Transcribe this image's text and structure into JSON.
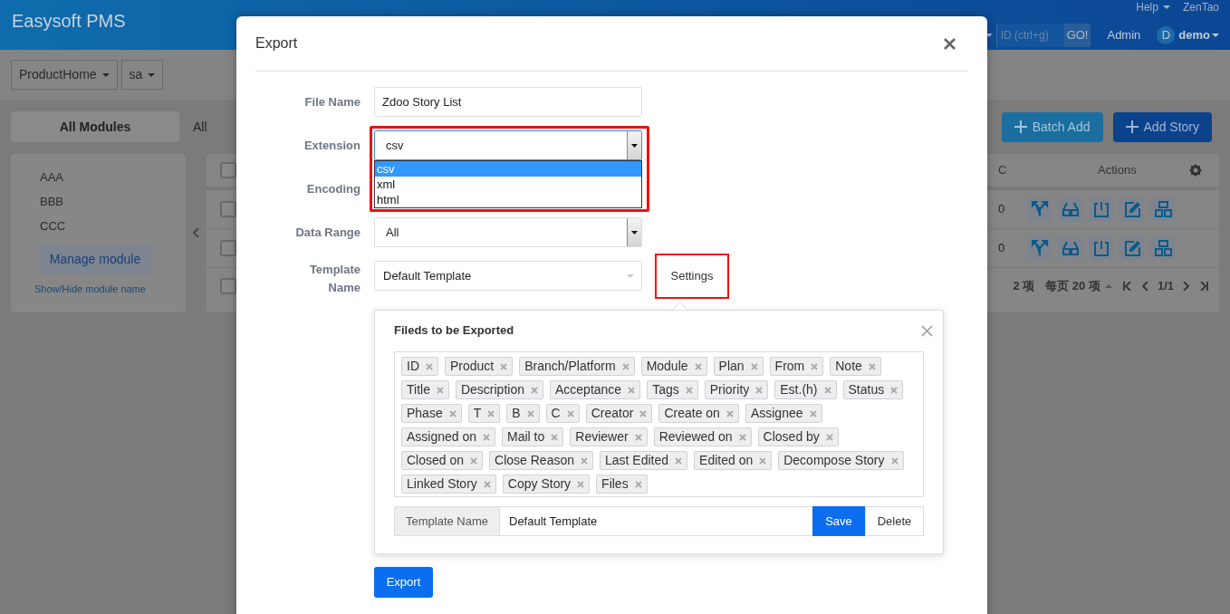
{
  "header": {
    "brand": "Easysoft PMS",
    "help": "Help",
    "zentao": "ZenTao",
    "search": {
      "placeholder": "ID (ctrl+g)"
    },
    "go": "GO!",
    "admin": "Admin",
    "avatar": "D",
    "user": "demo"
  },
  "breadcrumb": [
    "ProductHome",
    "sa"
  ],
  "sidebar": {
    "title": "All Modules",
    "modules": [
      "AAA",
      "BBB",
      "CCC"
    ],
    "manage": "Manage module",
    "toggle": "Show/Hide module name"
  },
  "toolbar": {
    "filter": "All",
    "buttons": [
      {
        "label": "Batch Add",
        "kind": "secondary"
      },
      {
        "label": "Add Story",
        "kind": "primary"
      }
    ]
  },
  "table": {
    "header_checked": false,
    "columns": [
      "C",
      "Actions"
    ],
    "rows": [
      {
        "checked": false,
        "c": "0"
      },
      {
        "checked": false,
        "c": "0"
      }
    ],
    "footer": {
      "checked": false,
      "total": "2 项",
      "per_page": "每页 20 项",
      "page": "1/1"
    }
  },
  "dialog": {
    "title": "Export",
    "fields": [
      {
        "label": "File Name",
        "kind": "text",
        "value": "Zdoo Story List"
      },
      {
        "label": "Extension",
        "kind": "select",
        "value": "csv",
        "highlighted": true,
        "expanded": true,
        "options": [
          {
            "label": "csv",
            "selected": true
          },
          {
            "label": "xml",
            "selected": false
          },
          {
            "label": "html",
            "selected": false
          }
        ]
      },
      {
        "label": "Encoding"
      },
      {
        "label": "Data Range",
        "kind": "select",
        "value": "All"
      },
      {
        "label": "Template Name",
        "kind": "chosen",
        "value": "Default Template",
        "button": "Settings",
        "button_highlighted": true
      }
    ],
    "popover": {
      "title": "Fileds to be Exported",
      "tags": [
        "ID",
        "Product",
        "Branch/Platform",
        "Module",
        "Plan",
        "From",
        "Note",
        "Title",
        "Description",
        "Acceptance",
        "Tags",
        "Priority",
        "Est.(h)",
        "Status",
        "Phase",
        "T",
        "B",
        "C",
        "Creator",
        "Create on",
        "Assignee",
        "Assigned on",
        "Mail to",
        "Reviewer",
        "Reviewed on",
        "Closed by",
        "Closed on",
        "Close Reason",
        "Last Edited",
        "Edited on",
        "Decompose Story",
        "Linked Story",
        "Copy Story",
        "Files"
      ],
      "template_label": "Template Name",
      "template_value": "Default Template",
      "save": "Save",
      "delete": "Delete"
    },
    "export": "Export"
  }
}
